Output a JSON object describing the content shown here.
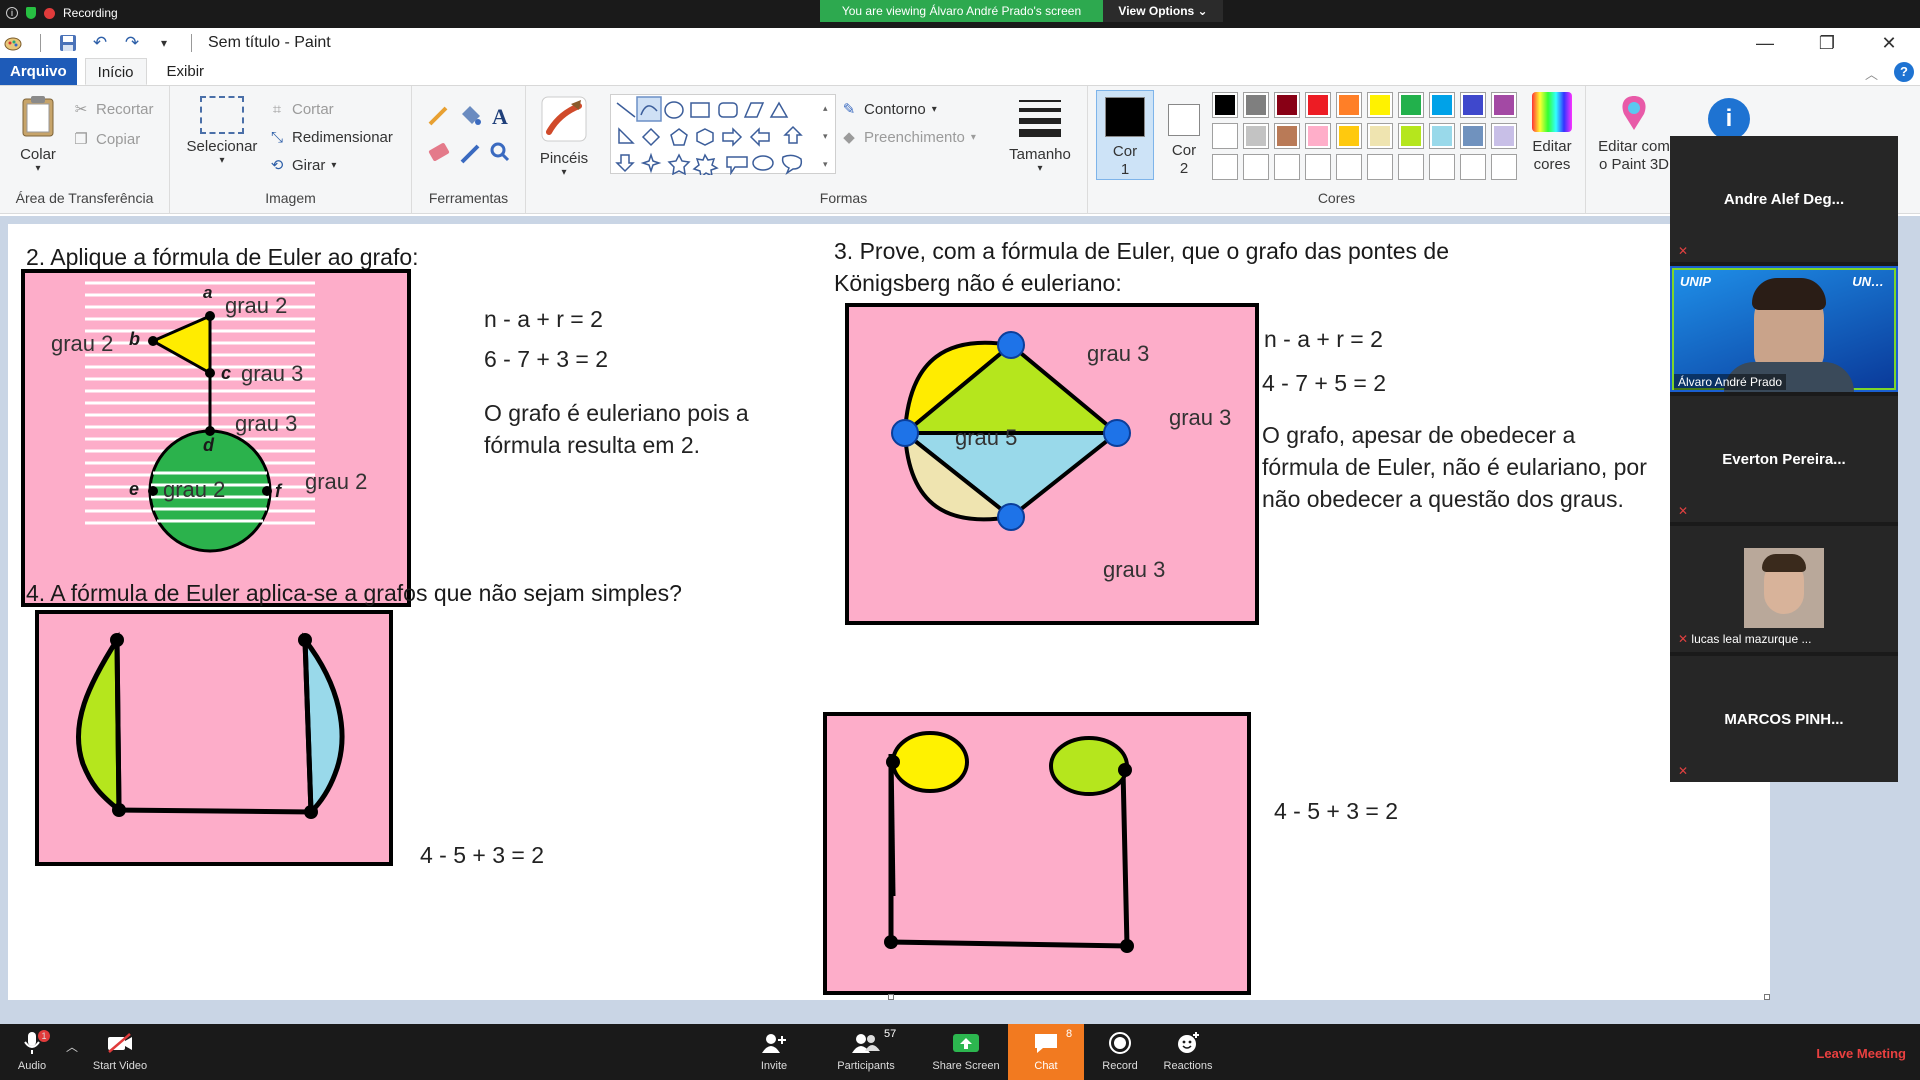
{
  "zoom_top": {
    "recording_label": "Recording",
    "viewing_banner": "You are viewing Álvaro André Prado's screen",
    "view_options_label": "View Options"
  },
  "paint": {
    "window_title": "Sem título - Paint",
    "menu": {
      "file": "Arquivo",
      "home": "Início",
      "view": "Exibir"
    },
    "clipboard": {
      "paste": "Colar",
      "cut": "Recortar",
      "copy": "Copiar",
      "group_name": "Área de Transferência"
    },
    "image": {
      "select": "Selecionar",
      "crop": "Cortar",
      "resize": "Redimensionar",
      "rotate": "Girar",
      "group_name": "Imagem"
    },
    "tools": {
      "group_name": "Ferramentas"
    },
    "brushes": {
      "label": "Pincéis"
    },
    "shapes": {
      "outline": "Contorno",
      "fill": "Preenchimento",
      "group_name": "Formas"
    },
    "size": {
      "label": "Tamanho"
    },
    "colors": {
      "color1": "Cor 1",
      "color1_line1": "Cor",
      "color1_line2": "1",
      "color2_line1": "Cor",
      "color2_line2": "2",
      "edit_colors_line1": "Editar",
      "edit_colors_line2": "cores",
      "paint3d_line1": "Editar com",
      "paint3d_line2": "o Paint 3D",
      "group_name": "Cores",
      "palette_row1": [
        "#000000",
        "#7f7f7f",
        "#880015",
        "#ed1c24",
        "#ff7f27",
        "#fff200",
        "#22b14c",
        "#00a2e8",
        "#3f48cc",
        "#a349a4"
      ],
      "palette_row2": [
        "#ffffff",
        "#c3c3c3",
        "#b97a57",
        "#ffaec9",
        "#ffc90e",
        "#efe4b0",
        "#b5e61d",
        "#99d9ea",
        "#7092be",
        "#c8bfe7"
      ]
    }
  },
  "canvas": {
    "q2_title": "2. Aplique a fórmula de Euler ao grafo:",
    "q2_eq1": "n - a + r = 2",
    "q2_eq2": "6 - 7 + 3 = 2",
    "q2_text1": "O grafo é euleriano pois a",
    "q2_text2": "fórmula resulta em 2.",
    "q2_labels": {
      "a": "a",
      "b": "b",
      "c": "c",
      "d": "d",
      "e": "e",
      "f": "f",
      "grau2_top": "grau 2",
      "grau2_left": "grau 2",
      "grau3_c": "grau 3",
      "grau3_d": "grau 3",
      "grau2_e": "grau 2",
      "grau2_f": "grau 2"
    },
    "q3_title_line1": "3. Prove, com a fórmula de Euler, que o grafo das pontes de",
    "q3_title_line2": "Königsberg não é euleriano:",
    "q3_eq1": "n - a + r = 2",
    "q3_eq2": "4 - 7 + 5 = 2",
    "q3_text1": "O grafo, apesar de obedecer a",
    "q3_text2": "fórmula de Euler, não é eulariano, por",
    "q3_text3": "não obedecer a questão dos graus.",
    "q3_labels": {
      "grau3_top": "grau 3",
      "grau5": "grau 5",
      "grau3_right": "grau 3",
      "grau3_bottom": "grau 3"
    },
    "q4_title": "4.  A fórmula de Euler aplica-se a grafos que não sejam simples?",
    "q4_eq_left": "4 - 5 + 3 = 2",
    "q4_eq_right": "4 - 5 + 3 = 2"
  },
  "participants": [
    {
      "name": "Andre Alef Deg...",
      "video": false
    },
    {
      "name": "Álvaro André Prado",
      "video": true
    },
    {
      "name": "Everton  Pereira...",
      "video": false
    },
    {
      "name": "lucas leal mazurque ...",
      "video": true
    },
    {
      "name": "MARCOS  PINH...",
      "video": false
    }
  ],
  "zoom_bottom": {
    "audio": "Audio",
    "start_video": "Start Video",
    "invite": "Invite",
    "participants": "Participants",
    "participants_count": "57",
    "share_screen": "Share Screen",
    "chat": "Chat",
    "chat_count": "8",
    "record": "Record",
    "reactions": "Reactions",
    "leave": "Leave Meeting",
    "audio_badge": "1"
  }
}
